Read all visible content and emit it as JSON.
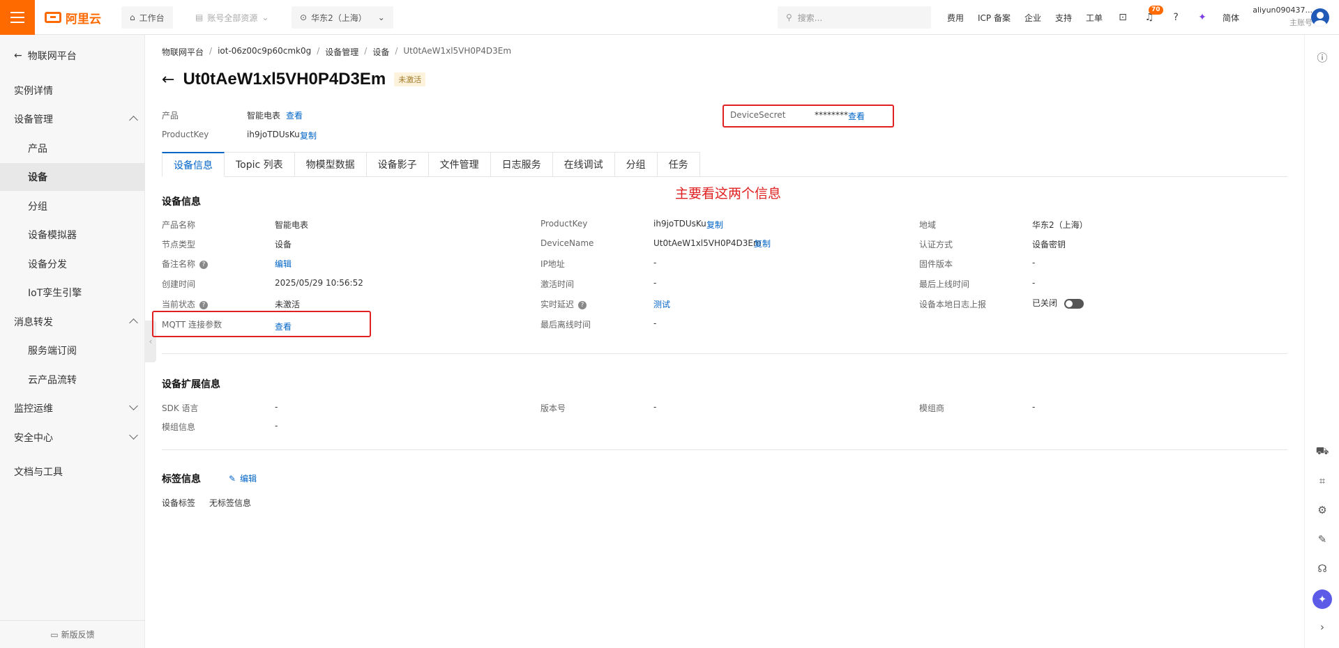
{
  "topbar": {
    "logo_text": "阿里云",
    "workbench": "工作台",
    "account_resources": "账号全部资源",
    "region": "华东2（上海）",
    "search_placeholder": "搜索...",
    "links": [
      "费用",
      "ICP 备案",
      "企业",
      "支持",
      "工单"
    ],
    "notification_count": "70",
    "language": "简体",
    "user_name": "aliyun090437...",
    "user_role": "主账号"
  },
  "sidebar": {
    "back_label": "物联网平台",
    "items": [
      {
        "label": "实例详情",
        "level": 1
      },
      {
        "label": "设备管理",
        "level": 1,
        "expanded": true
      },
      {
        "label": "产品",
        "level": 2
      },
      {
        "label": "设备",
        "level": 2,
        "active": true
      },
      {
        "label": "分组",
        "level": 2
      },
      {
        "label": "设备模拟器",
        "level": 2
      },
      {
        "label": "设备分发",
        "level": 2
      },
      {
        "label": "IoT孪生引擎",
        "level": 2
      },
      {
        "label": "消息转发",
        "level": 1,
        "expanded": true
      },
      {
        "label": "服务端订阅",
        "level": 2
      },
      {
        "label": "云产品流转",
        "level": 2
      },
      {
        "label": "监控运维",
        "level": 1,
        "expanded": false
      },
      {
        "label": "安全中心",
        "level": 1,
        "expanded": false
      },
      {
        "label": "文档与工具",
        "level": 1
      }
    ],
    "feedback": "新版反馈"
  },
  "breadcrumb": [
    "物联网平台",
    "iot-06z00c9p60cmk0g",
    "设备管理",
    "设备",
    "Ut0tAeW1xl5VH0P4D3Em"
  ],
  "header": {
    "device_name": "Ut0tAeW1xl5VH0P4D3Em",
    "status_tag": "未激活",
    "product_label": "产品",
    "product_value": "智能电表",
    "product_view": "查看",
    "productkey_label": "ProductKey",
    "productkey_value": "ih9joTDUsKu",
    "productkey_copy": "复制",
    "secret_label": "DeviceSecret",
    "secret_value": "********",
    "secret_view": "查看"
  },
  "annotation": "主要看这两个信息",
  "tabs": [
    "设备信息",
    "Topic 列表",
    "物模型数据",
    "设备影子",
    "文件管理",
    "日志服务",
    "在线调试",
    "分组",
    "任务"
  ],
  "device_info": {
    "title": "设备信息",
    "col1": [
      {
        "label": "产品名称",
        "value": "智能电表"
      },
      {
        "label": "节点类型",
        "value": "设备"
      },
      {
        "label": "备注名称",
        "value": "编辑",
        "help": true
      },
      {
        "label": "创建时间",
        "value": "2025/05/29 10:56:52"
      },
      {
        "label": "当前状态",
        "value": "未激活",
        "help": true
      },
      {
        "label": "MQTT 连接参数",
        "value": "查看"
      }
    ],
    "col2": [
      {
        "label": "ProductKey",
        "value": "ih9joTDUsKu",
        "action": "复制"
      },
      {
        "label": "DeviceName",
        "value": "Ut0tAeW1xl5VH0P4D3Em",
        "action": "复制"
      },
      {
        "label": "IP地址",
        "value": "-"
      },
      {
        "label": "激活时间",
        "value": "-"
      },
      {
        "label": "实时延迟",
        "value": "测试",
        "help": true
      },
      {
        "label": "最后离线时间",
        "value": "-"
      }
    ],
    "col3": [
      {
        "label": "地域",
        "value": "华东2（上海）"
      },
      {
        "label": "认证方式",
        "value": "设备密钥"
      },
      {
        "label": "固件版本",
        "value": "-"
      },
      {
        "label": "最后上线时间",
        "value": "-"
      },
      {
        "label": "设备本地日志上报",
        "value": "已关闭"
      }
    ]
  },
  "ext_info": {
    "title": "设备扩展信息",
    "rows": [
      {
        "label": "SDK 语言",
        "value": "-"
      },
      {
        "label": "模组信息",
        "value": "-"
      },
      {
        "label": "版本号",
        "value": "-"
      },
      {
        "label": "模组商",
        "value": "-"
      }
    ]
  },
  "tag_info": {
    "title": "标签信息",
    "edit": "编辑",
    "label": "设备标签",
    "value": "无标签信息"
  }
}
